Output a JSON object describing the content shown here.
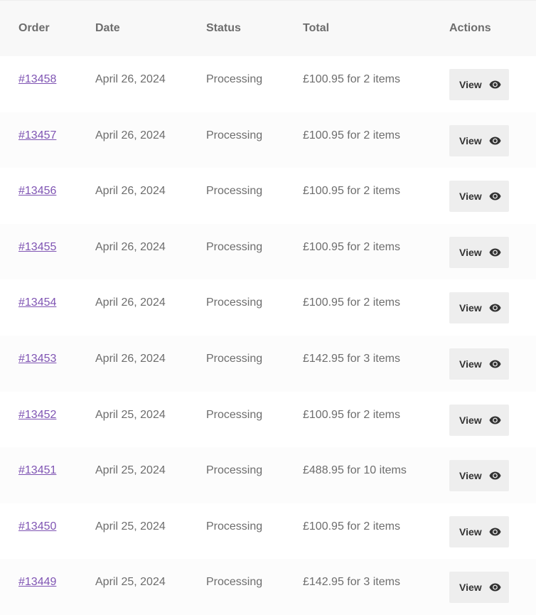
{
  "table": {
    "headers": {
      "order": "Order",
      "date": "Date",
      "status": "Status",
      "total": "Total",
      "actions": "Actions"
    },
    "rows": [
      {
        "order": "#13458",
        "date": "April 26, 2024",
        "status": "Processing",
        "total": "£100.95 for 2 items",
        "action": "View"
      },
      {
        "order": "#13457",
        "date": "April 26, 2024",
        "status": "Processing",
        "total": "£100.95 for 2 items",
        "action": "View"
      },
      {
        "order": "#13456",
        "date": "April 26, 2024",
        "status": "Processing",
        "total": "£100.95 for 2 items",
        "action": "View"
      },
      {
        "order": "#13455",
        "date": "April 26, 2024",
        "status": "Processing",
        "total": "£100.95 for 2 items",
        "action": "View"
      },
      {
        "order": "#13454",
        "date": "April 26, 2024",
        "status": "Processing",
        "total": "£100.95 for 2 items",
        "action": "View"
      },
      {
        "order": "#13453",
        "date": "April 26, 2024",
        "status": "Processing",
        "total": "£142.95 for 3 items",
        "action": "View"
      },
      {
        "order": "#13452",
        "date": "April 25, 2024",
        "status": "Processing",
        "total": "£100.95 for 2 items",
        "action": "View"
      },
      {
        "order": "#13451",
        "date": "April 25, 2024",
        "status": "Processing",
        "total": "£488.95 for 10 items",
        "action": "View"
      },
      {
        "order": "#13450",
        "date": "April 25, 2024",
        "status": "Processing",
        "total": "£100.95 for 2 items",
        "action": "View"
      },
      {
        "order": "#13449",
        "date": "April 25, 2024",
        "status": "Processing",
        "total": "£142.95 for 3 items",
        "action": "View"
      }
    ]
  },
  "icons": {
    "view": "eye-icon"
  },
  "colors": {
    "link": "#7f54b3",
    "text": "#6d6d6d",
    "header_bg": "#f8f8f8",
    "button_bg": "#eeeeee"
  }
}
